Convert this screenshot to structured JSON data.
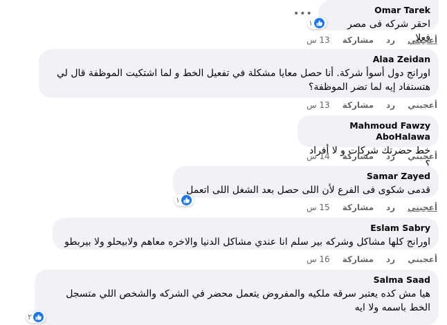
{
  "comments": [
    {
      "author": "Omar Tarek",
      "text": "احقر شركه فى مصر فعلا",
      "reactions": "١",
      "like": "أعجبني",
      "reply": "رد",
      "share": "مشاركة",
      "time": "13 س"
    },
    {
      "author": "Alaa Zeidan",
      "text": "اورانج دول أسوأ شركة. أنا حصل معايا مشكلة في تفعيل الخط و لما اشتكيت الموظفة قال لي هتستفاد إيه لما تضر الموظفة؟",
      "like": "أعجبني",
      "reply": "رد",
      "share": "مشاركة",
      "time": "13 س"
    },
    {
      "author": "Mahmoud Fawzy AboHalawa",
      "text": "خط حضرتك شركات و لا أفراد ؟",
      "like": "أعجبني",
      "reply": "رد",
      "share": "مشاركة",
      "time": "14 س"
    },
    {
      "author": "Samar Zayed",
      "text": "قدمى شكوى فى الفرع لأن اللى حصل بعد الشغل اللى اتعمل",
      "reactions": "١",
      "like": "أعجبني",
      "reply": "رد",
      "share": "مشاركة",
      "time": "15 س"
    },
    {
      "author": "Eslam Sabry",
      "text": "اورانج كلها مشاكل وشركه بير سلم انا عندي مشاكل الدنيا والاخره معاهم ولابيحلو ولا بيربطو",
      "like": "أعجبني",
      "reply": "رد",
      "share": "مشاركة",
      "time": "16 س"
    },
    {
      "author": "Salma Saad",
      "text": "هيا مش كده يعتبر سرقه ملكيه والمفروض يتعمل محضر في الشركه والشخص اللي متسجل الخط باسمه ولا ايه",
      "reactions": "٢"
    }
  ],
  "icons": {
    "more": "more-options-icon",
    "like": "like-icon"
  },
  "colors": {
    "bubble": "#f0f2f5",
    "like_blue": "#1877f2",
    "meta": "#65676b"
  }
}
